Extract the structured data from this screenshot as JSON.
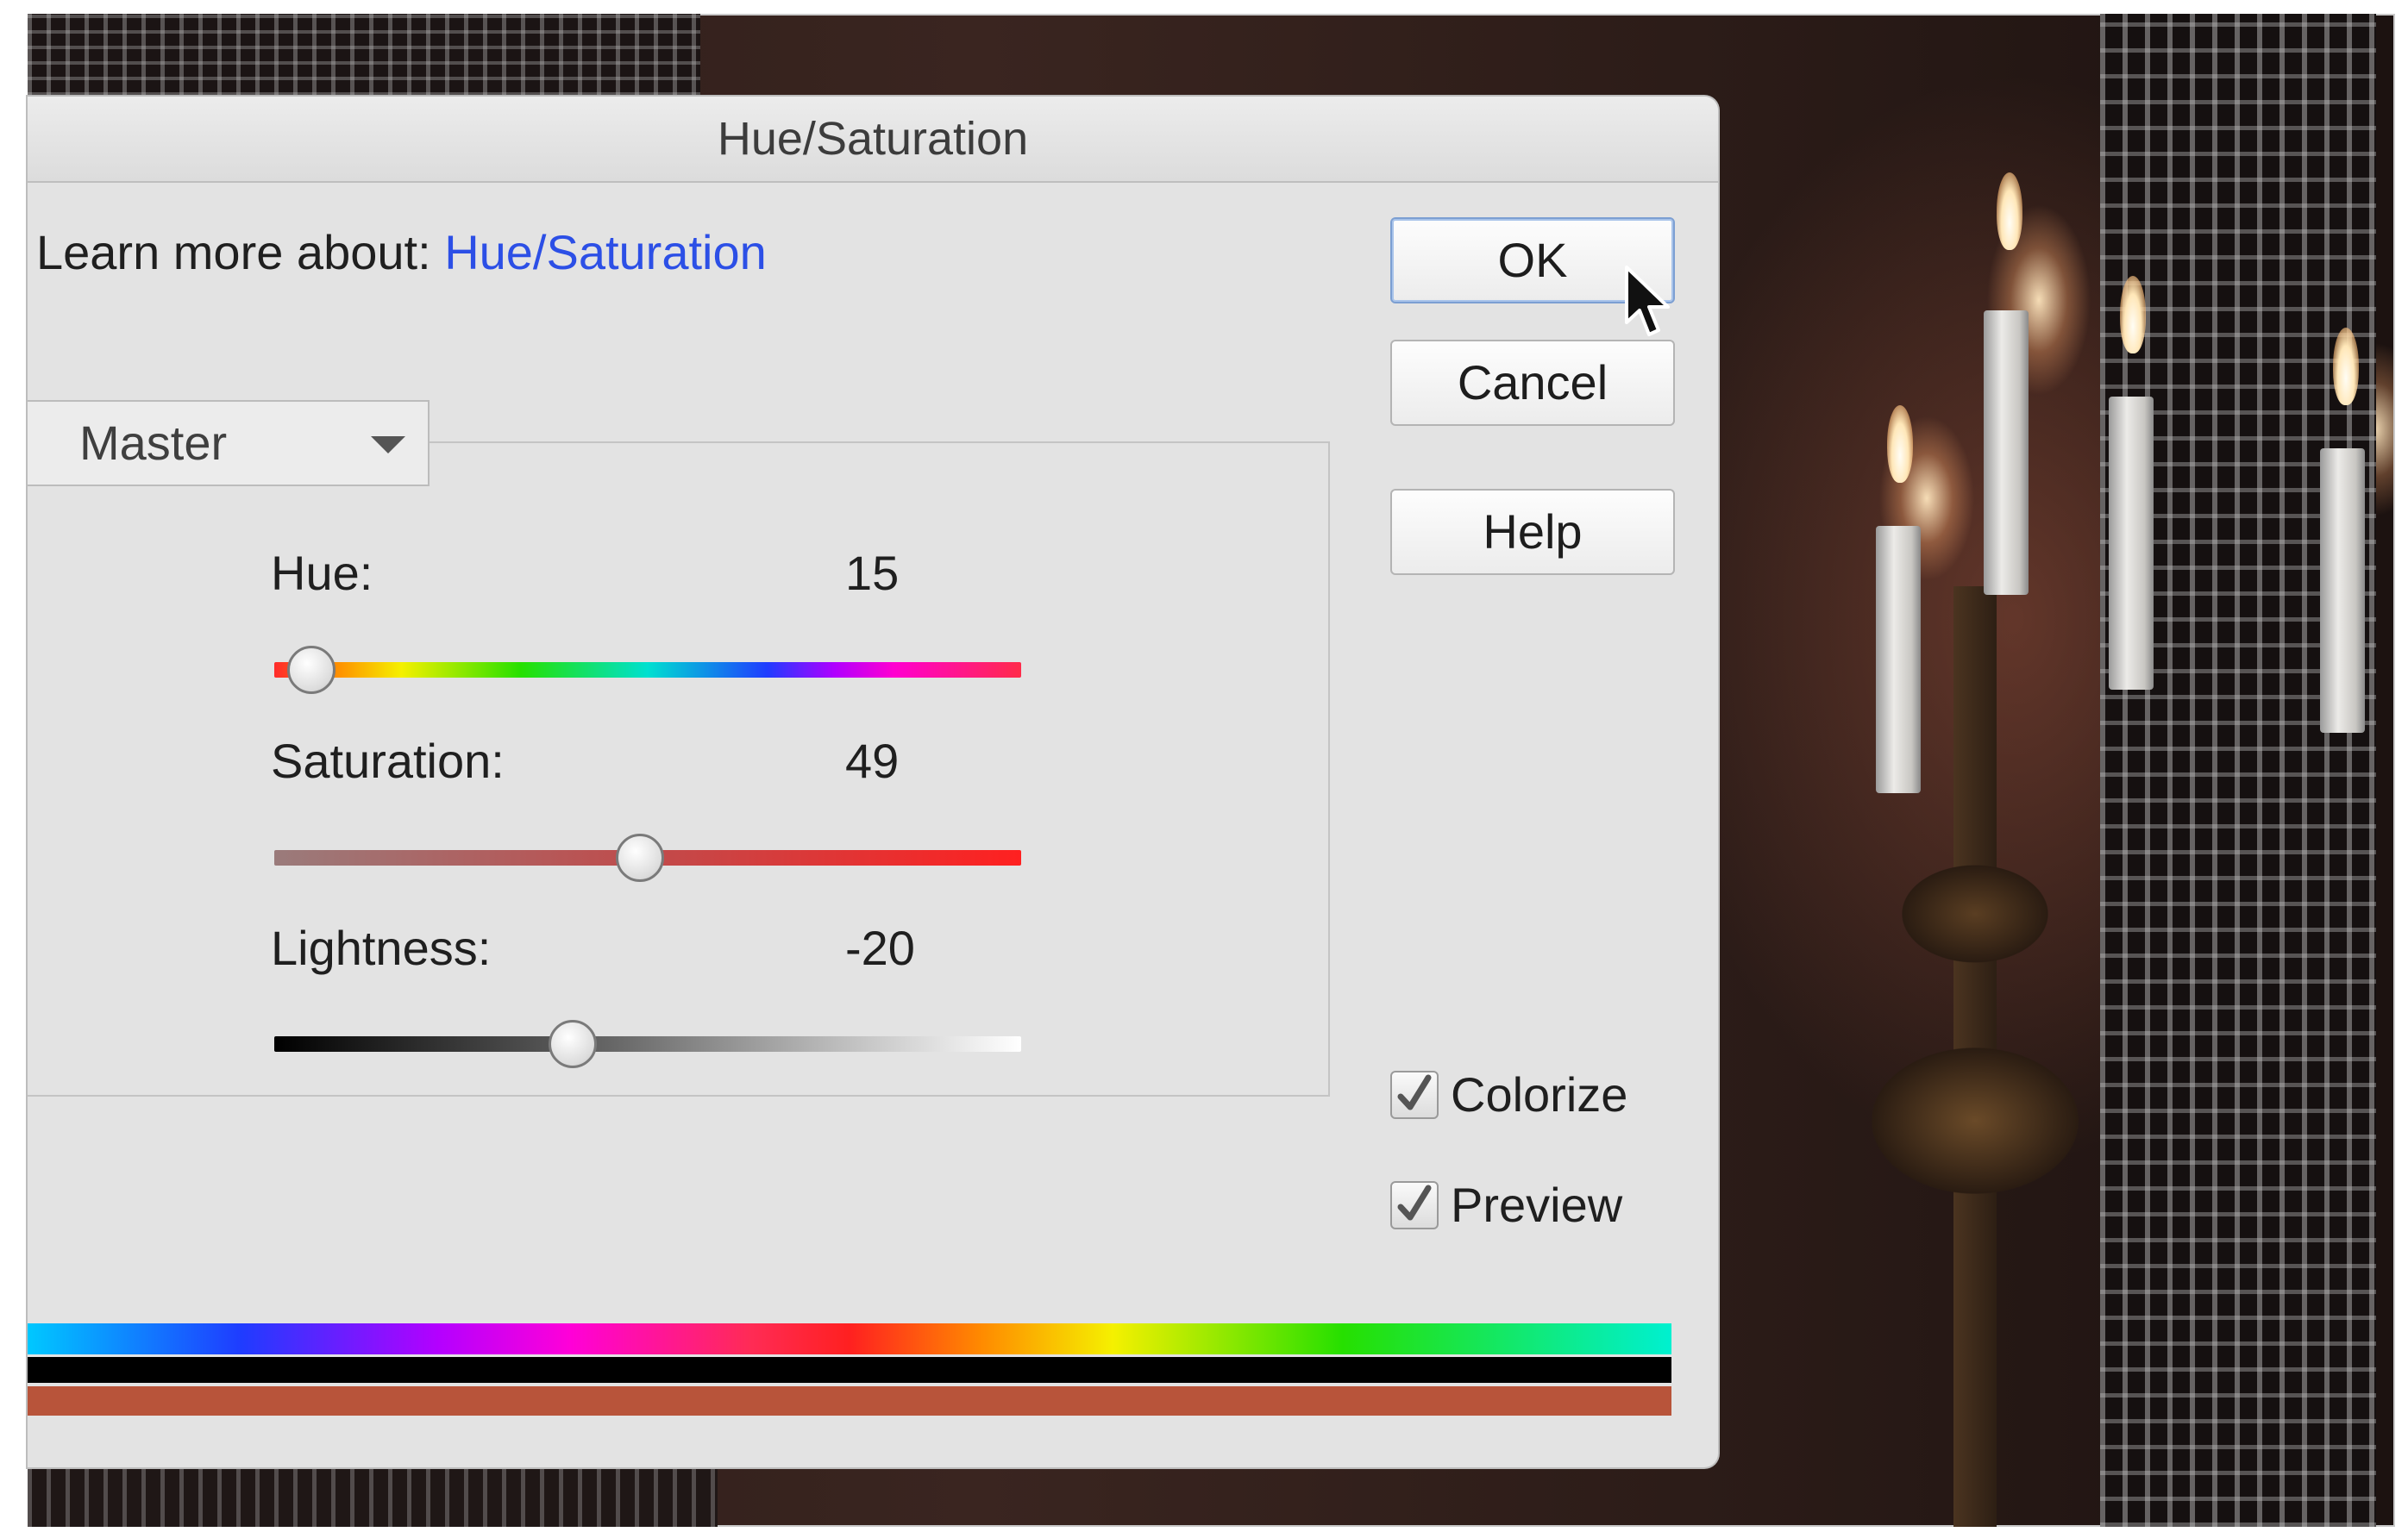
{
  "dialog": {
    "title": "Hue/Saturation",
    "learn_more_prefix": "Learn more about:",
    "learn_more_link": "Hue/Saturation"
  },
  "buttons": {
    "ok": "OK",
    "cancel": "Cancel",
    "help": "Help"
  },
  "channel_select": {
    "value": "Master"
  },
  "sliders": {
    "hue": {
      "label": "Hue:",
      "value": "15",
      "position_fraction": 0.05
    },
    "saturation": {
      "label": "Saturation:",
      "value": "49",
      "position_fraction": 0.49
    },
    "lightness": {
      "label": "Lightness:",
      "value": "-20",
      "position_fraction": 0.4
    }
  },
  "checkboxes": {
    "colorize": {
      "label": "Colorize",
      "checked": true
    },
    "preview": {
      "label": "Preview",
      "checked": true
    }
  },
  "colors": {
    "link": "#2c4fe6",
    "result_bar": "#b8543a"
  },
  "icons": {
    "cursor": "arrow-cursor-icon",
    "dropdown": "chevron-down-icon",
    "check": "checkmark-icon"
  }
}
